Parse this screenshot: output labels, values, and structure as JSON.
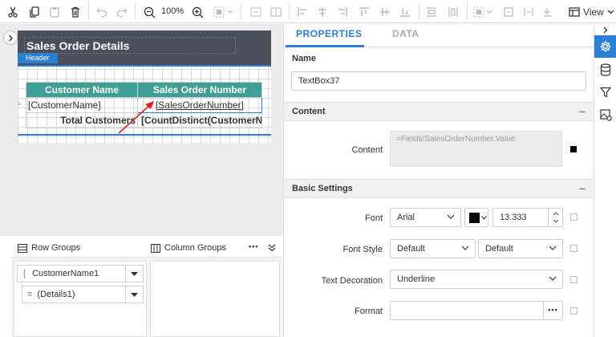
{
  "toolbar": {
    "zoom": "100%",
    "view_label": "View"
  },
  "report": {
    "title": "Sales Order Details",
    "section_tag": "Header",
    "table": {
      "headers": [
        "Customer Name",
        "Sales Order Number"
      ],
      "row": [
        "[CustomerName]",
        "[SalesOrderNumber]"
      ],
      "total": [
        "Total Customers",
        "[CountDistinct(CustomerNam"
      ]
    }
  },
  "groups": {
    "row_title": "Row Groups",
    "column_title": "Column Groups",
    "more": "•••",
    "row_items": [
      "CustomerName1",
      "(Details1)"
    ]
  },
  "properties": {
    "tabs": [
      "PROPERTIES",
      "DATA"
    ],
    "name_label": "Name",
    "name_value": "TextBox37",
    "content_section": "Content",
    "content_label": "Content",
    "content_value": "=Fields!SalesOrderNumber.Value",
    "basic_section": "Basic Settings",
    "font_label": "Font",
    "font_family": "Arial",
    "font_size": "13.333",
    "font_color": "#000000",
    "font_style_label": "Font Style",
    "font_style": "Default",
    "font_weight": "Default",
    "text_decoration_label": "Text Decoration",
    "text_decoration": "Underline",
    "format_label": "Format",
    "format_more": "•••",
    "collapse_symbol": "−"
  },
  "colors": {
    "accent": "#2b7fd5",
    "header_bg": "#4a4f59",
    "table_header": "#3f9e96",
    "arrow": "#e02020"
  },
  "icons": {
    "toolbar": [
      "cut-icon",
      "copy-icon",
      "paste-icon",
      "delete-icon",
      "undo-icon",
      "redo-icon",
      "zoom-out-icon",
      "zoom-in-icon",
      "select-icon",
      "align-icons",
      "view-icon"
    ],
    "strip": [
      "chevron-right-icon",
      "gear-icon",
      "database-icon",
      "filter-icon",
      "image-settings-icon"
    ]
  }
}
